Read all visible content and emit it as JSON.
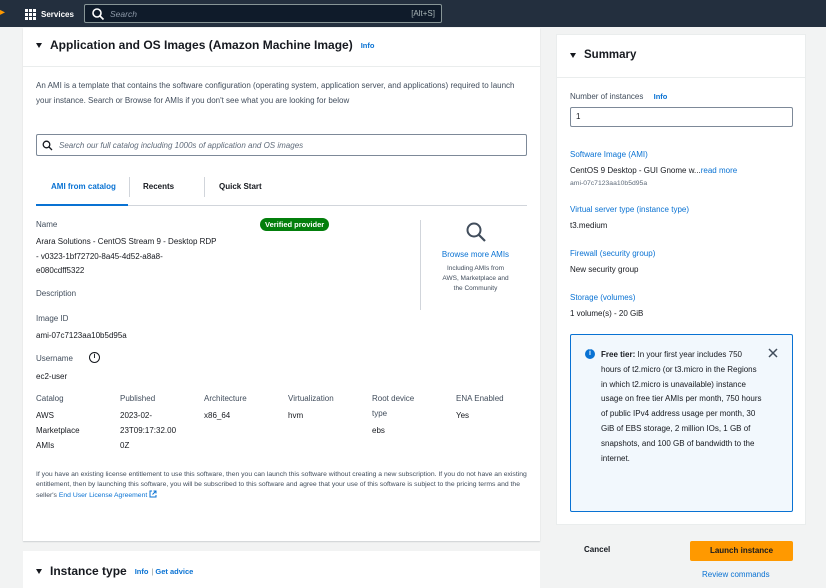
{
  "topbar": {
    "services_label": "Services",
    "search_placeholder": "Search",
    "search_shortcut": "[Alt+S]"
  },
  "ami_section": {
    "title": "Application and OS Images (Amazon Machine Image)",
    "info": "Info",
    "description": "An AMI is a template that contains the software configuration (operating system, application server, and applications) required to launch your instance. Search or Browse for AMIs if you don't see what you are looking for below",
    "search_placeholder": "Search our full catalog including 1000s of application and OS images",
    "tabs": [
      "AMI from catalog",
      "Recents",
      "Quick Start"
    ],
    "name_label": "Name",
    "name_lines": [
      "Arara Solutions - CentOS Stream 9 - Desktop RDP",
      "- v0323-1bf72720-8a45-4d52-a8a8-",
      "e080cdff5322"
    ],
    "verified_badge": "Verified provider",
    "description_label": "Description",
    "image_id_label": "Image ID",
    "image_id": "ami-07c7123aa10b5d95a",
    "username_label": "Username",
    "username": "ec2-user",
    "browse_link": "Browse more AMIs",
    "browse_sub": [
      "Including AMIs from",
      "AWS, Marketplace and",
      "the Community"
    ],
    "details": {
      "catalog_label": "Catalog",
      "catalog_lines": [
        "AWS",
        "Marketplace",
        "AMIs"
      ],
      "published_label": "Published",
      "published_lines": [
        "2023-02-",
        "23T09:17:32.00",
        "0Z"
      ],
      "architecture_label": "Architecture",
      "architecture": "x86_64",
      "virtualization_label": "Virtualization",
      "virtualization": "hvm",
      "root_device_label_lines": [
        "Root device",
        "type"
      ],
      "root_device": "ebs",
      "ena_label": "ENA Enabled",
      "ena": "Yes"
    },
    "fine_print": "If you have an existing license entitlement to use this software, then you can launch this software without creating a new subscription. If you do not have an existing entitlement, then by launching this software, you will be subscribed to this software and agree that your use of this software is subject to the pricing terms and the seller's",
    "eula_link": "End User License Agreement"
  },
  "instance_type_section": {
    "title": "Instance type",
    "info": "Info",
    "separator": "|",
    "advice": "Get advice"
  },
  "summary": {
    "title": "Summary",
    "instances_label": "Number of instances",
    "info": "Info",
    "instances_value": "1",
    "software_image_label": "Software Image (AMI)",
    "software_image_value": "CentOS 9 Desktop - GUI Gnome w...",
    "read_more": "read more",
    "software_image_id": "ami-07c7123aa10b5d95a",
    "server_type_label": "Virtual server type (instance type)",
    "server_type_value": "t3.medium",
    "firewall_label": "Firewall (security group)",
    "firewall_value": "New security group",
    "storage_label": "Storage (volumes)",
    "storage_value": "1 volume(s) - 20 GiB",
    "free_tier_title": "Free tier:",
    "free_tier_text": "In your first year includes 750 hours of t2.micro (or t3.micro in the Regions in which t2.micro is unavailable) instance usage on free tier AMIs per month, 750 hours of public IPv4 address usage per month, 30 GiB of EBS storage, 2 million IOs, 1 GB of snapshots, and 100 GB of bandwidth to the internet.",
    "cancel": "Cancel",
    "launch": "Launch instance",
    "review": "Review commands"
  },
  "colors": {
    "topbar": "#232f3e",
    "accent": "#ff9900",
    "link": "#0972d3",
    "verified": "#037f0c"
  }
}
